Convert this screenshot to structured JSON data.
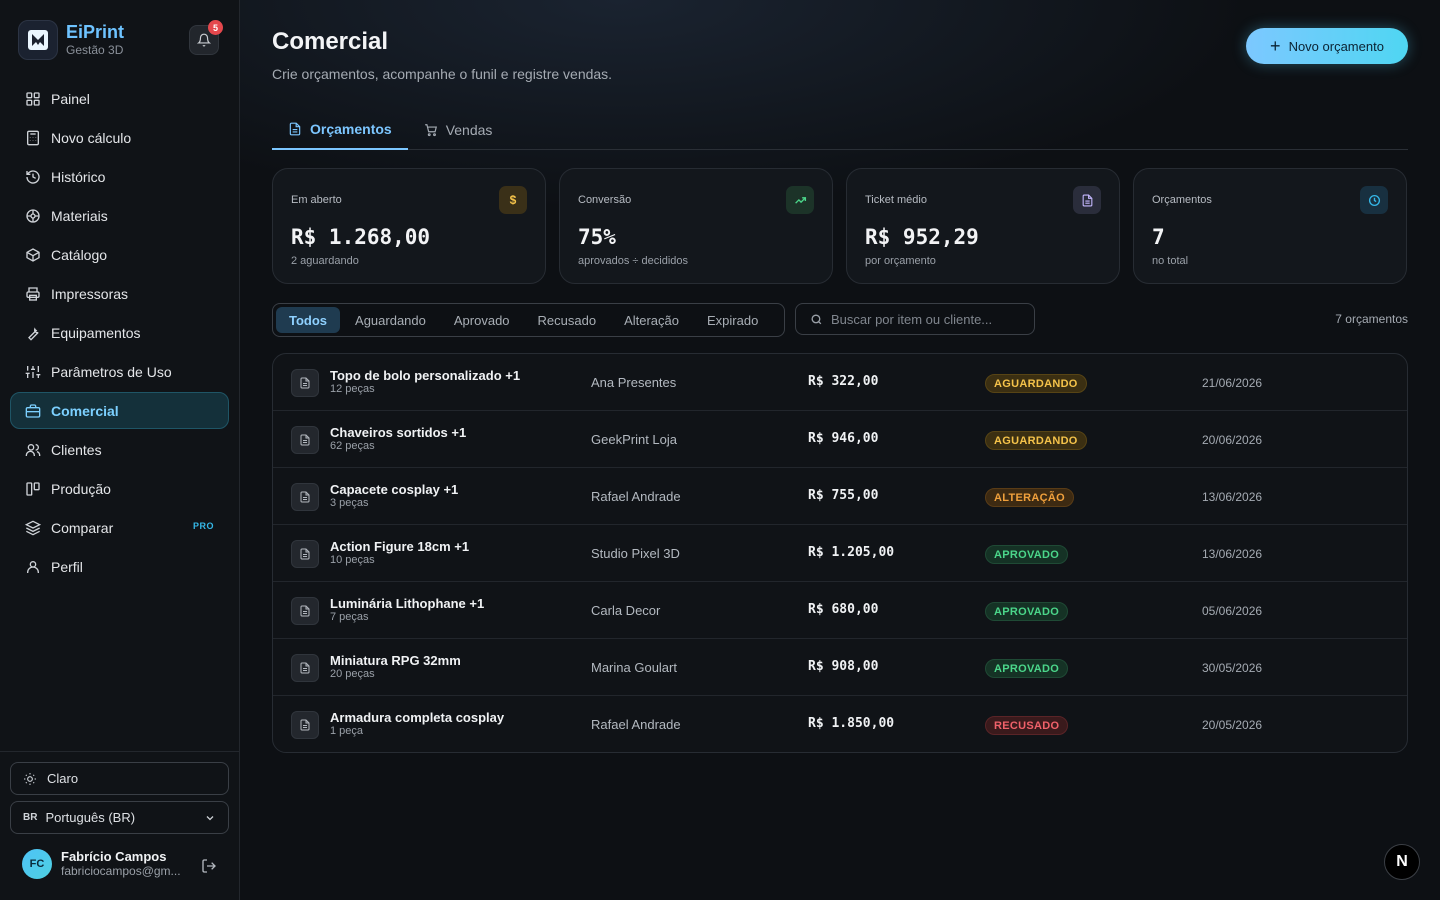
{
  "brand": {
    "name": "EiPrint",
    "subtitle": "Gestão 3D"
  },
  "notifications": {
    "count": "5"
  },
  "sidebar": {
    "items": [
      {
        "label": "Painel",
        "icon": "grid-icon"
      },
      {
        "label": "Novo cálculo",
        "icon": "calculator-icon"
      },
      {
        "label": "Histórico",
        "icon": "history-icon"
      },
      {
        "label": "Materiais",
        "icon": "spool-icon"
      },
      {
        "label": "Catálogo",
        "icon": "box-icon"
      },
      {
        "label": "Impressoras",
        "icon": "printer-icon"
      },
      {
        "label": "Equipamentos",
        "icon": "wrench-icon"
      },
      {
        "label": "Parâmetros de Uso",
        "icon": "sliders-icon"
      },
      {
        "label": "Comercial",
        "icon": "briefcase-icon",
        "active": true
      },
      {
        "label": "Clientes",
        "icon": "users-icon"
      },
      {
        "label": "Produção",
        "icon": "kanban-icon"
      },
      {
        "label": "Comparar",
        "icon": "layers-icon",
        "badge": "PRO"
      },
      {
        "label": "Perfil",
        "icon": "user-icon"
      }
    ],
    "theme_label": "Claro",
    "language": {
      "flag": "BR",
      "label": "Português (BR)"
    },
    "user": {
      "initials": "FC",
      "name": "Fabrício Campos",
      "email": "fabriciocampos@gm..."
    }
  },
  "header": {
    "title": "Comercial",
    "subtitle": "Crie orçamentos, acompanhe o funil e registre vendas.",
    "new_button": "Novo orçamento"
  },
  "tabs": [
    {
      "label": "Orçamentos",
      "active": true
    },
    {
      "label": "Vendas",
      "active": false
    }
  ],
  "stats": [
    {
      "label": "Em aberto",
      "value": "R$ 1.268,00",
      "note": "2 aguardando",
      "icon": "$",
      "icon_color": "#f5c34a",
      "icon_bg": "#3a3018"
    },
    {
      "label": "Conversão",
      "value": "75%",
      "note": "aprovados ÷ decididos",
      "icon": "trend-up-icon",
      "icon_color": "#4bd68a",
      "icon_bg": "#1c3328"
    },
    {
      "label": "Ticket médio",
      "value": "R$ 952,29",
      "note": "por orçamento",
      "icon": "document-icon",
      "icon_color": "#c5b8ff",
      "icon_bg": "#2a2d3b"
    },
    {
      "label": "Orçamentos",
      "value": "7",
      "note": "no total",
      "icon": "clock-icon",
      "icon_color": "#35b8e8",
      "icon_bg": "#183040"
    }
  ],
  "filters": [
    "Todos",
    "Aguardando",
    "Aprovado",
    "Recusado",
    "Alteração",
    "Expirado"
  ],
  "active_filter": "Todos",
  "search": {
    "placeholder": "Buscar por item ou cliente..."
  },
  "count_label": "7 orçamentos",
  "quotes": [
    {
      "title": "Topo de bolo personalizado +1",
      "qty": "12 peças",
      "client": "Ana Presentes",
      "value": "R$ 322,00",
      "status": "AGUARDANDO",
      "status_class": "st-aguardando",
      "date": "21/06/2026"
    },
    {
      "title": "Chaveiros sortidos +1",
      "qty": "62 peças",
      "client": "GeekPrint Loja",
      "value": "R$ 946,00",
      "status": "AGUARDANDO",
      "status_class": "st-aguardando",
      "date": "20/06/2026"
    },
    {
      "title": "Capacete cosplay +1",
      "qty": "3 peças",
      "client": "Rafael Andrade",
      "value": "R$ 755,00",
      "status": "ALTERAÇÃO",
      "status_class": "st-alteracao",
      "date": "13/06/2026"
    },
    {
      "title": "Action Figure 18cm +1",
      "qty": "10 peças",
      "client": "Studio Pixel 3D",
      "value": "R$ 1.205,00",
      "status": "APROVADO",
      "status_class": "st-aprovado",
      "date": "13/06/2026"
    },
    {
      "title": "Luminária Lithophane +1",
      "qty": "7 peças",
      "client": "Carla Decor",
      "value": "R$ 680,00",
      "status": "APROVADO",
      "status_class": "st-aprovado",
      "date": "05/06/2026"
    },
    {
      "title": "Miniatura RPG 32mm",
      "qty": "20 peças",
      "client": "Marina Goulart",
      "value": "R$ 908,00",
      "status": "APROVADO",
      "status_class": "st-aprovado",
      "date": "30/05/2026"
    },
    {
      "title": "Armadura completa cosplay",
      "qty": "1 peça",
      "client": "Rafael Andrade",
      "value": "R$ 1.850,00",
      "status": "RECUSADO",
      "status_class": "st-recusado",
      "date": "20/05/2026"
    }
  ],
  "corner_badge": "N"
}
